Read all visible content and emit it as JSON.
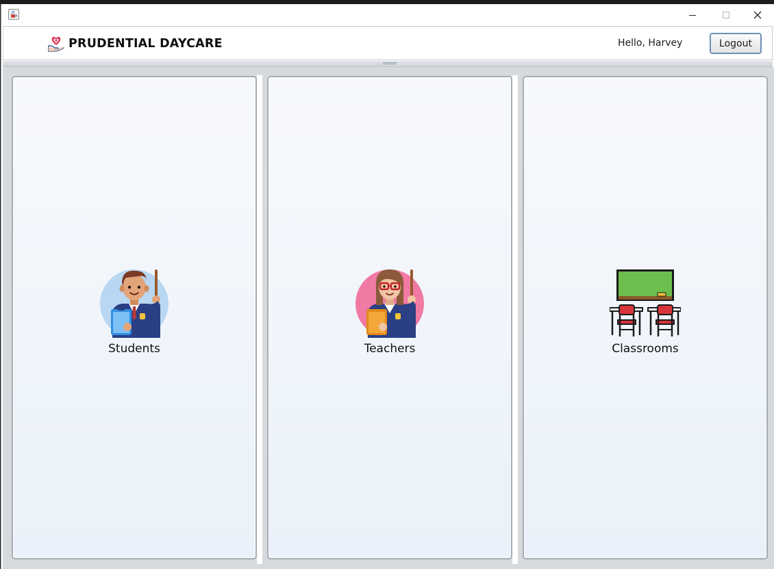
{
  "window": {
    "title_icon": "java-cup-icon",
    "controls": [
      "minimize-icon",
      "maximize-icon",
      "close-icon"
    ]
  },
  "header": {
    "logo_icon": "heart-hands-logo-icon",
    "title": "PRUDENTIAL DAYCARE",
    "greeting": "Hello, Harvey",
    "logout_label": "Logout"
  },
  "tiles": [
    {
      "label": "Students",
      "icon": "male-teacher-icon"
    },
    {
      "label": "Teachers",
      "icon": "female-teacher-icon"
    },
    {
      "label": "Classrooms",
      "icon": "classroom-desks-icon"
    }
  ],
  "colors": {
    "logout_border": "#6d8fb8",
    "students_icon_bg": "#b9d7f2",
    "teachers_icon_bg": "#f07aa3",
    "chalkboard": "#6cbf4d"
  }
}
